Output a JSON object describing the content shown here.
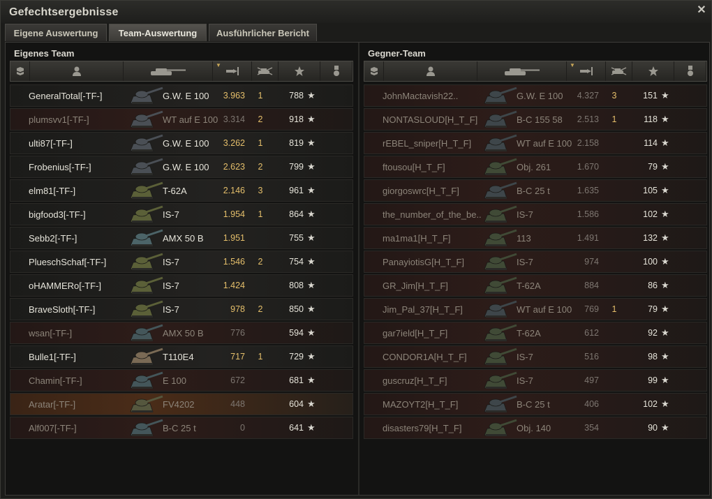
{
  "window": {
    "title": "Gefechtsergebnisse"
  },
  "tabs": [
    {
      "label": "Eigene Auswertung"
    },
    {
      "label": "Team-Auswertung"
    },
    {
      "label": "Ausführlicher Bericht"
    }
  ],
  "colors": {
    "accent": "#e5bf6b",
    "dead_row": "#2d1c19",
    "highlight_row": "#4a2c18"
  },
  "icons": {
    "header": [
      "squad-icon",
      "player-icon",
      "tank-icon",
      "damage-icon",
      "kills-icon",
      "xp-star-icon",
      "medal-icon"
    ],
    "row_star": "★"
  },
  "own_team": {
    "title": "Eigenes Team",
    "rows": [
      {
        "name": "GeneralTotal[-TF-]",
        "vehicle": "G.W. E 100",
        "damage": "3.963",
        "kills": "1",
        "xp": "788",
        "dead": false,
        "tank_color": "#4a4f55"
      },
      {
        "name": "plumsvv1[-TF-]",
        "vehicle": "WT auf E 100",
        "damage": "3.314",
        "kills": "2",
        "xp": "918",
        "dead": true,
        "tank_color": "#4a4f55"
      },
      {
        "name": "ulti87[-TF-]",
        "vehicle": "G.W. E 100",
        "damage": "3.262",
        "kills": "1",
        "xp": "819",
        "dead": false,
        "tank_color": "#4a4f55"
      },
      {
        "name": "Frobenius[-TF-]",
        "vehicle": "G.W. E 100",
        "damage": "2.623",
        "kills": "2",
        "xp": "799",
        "dead": false,
        "tank_color": "#4a4f55"
      },
      {
        "name": "elm81[-TF-]",
        "vehicle": "T-62A",
        "damage": "2.146",
        "kills": "3",
        "xp": "961",
        "dead": false,
        "tank_color": "#5b6038"
      },
      {
        "name": "bigfood3[-TF-]",
        "vehicle": "IS-7",
        "damage": "1.954",
        "kills": "1",
        "xp": "864",
        "dead": false,
        "tank_color": "#5b6038"
      },
      {
        "name": "Sebb2[-TF-]",
        "vehicle": "AMX 50 B",
        "damage": "1.951",
        "kills": "",
        "xp": "755",
        "dead": false,
        "tank_color": "#4c6468"
      },
      {
        "name": "PlueschSchaf[-TF-]",
        "vehicle": "IS-7",
        "damage": "1.546",
        "kills": "2",
        "xp": "754",
        "dead": false,
        "tank_color": "#5b6038"
      },
      {
        "name": "oHAMMERo[-TF-]",
        "vehicle": "IS-7",
        "damage": "1.424",
        "kills": "",
        "xp": "808",
        "dead": false,
        "tank_color": "#5b6038"
      },
      {
        "name": "BraveSloth[-TF-]",
        "vehicle": "IS-7",
        "damage": "978",
        "kills": "2",
        "xp": "850",
        "dead": false,
        "tank_color": "#5b6038"
      },
      {
        "name": "wsan[-TF-]",
        "vehicle": "AMX 50 B",
        "damage": "776",
        "kills": "",
        "xp": "594",
        "dead": true,
        "tank_color": "#44565a"
      },
      {
        "name": "Bulle1[-TF-]",
        "vehicle": "T110E4",
        "damage": "717",
        "kills": "1",
        "xp": "729",
        "dead": false,
        "tank_color": "#7a6a55"
      },
      {
        "name": "Chamin[-TF-]",
        "vehicle": "E 100",
        "damage": "672",
        "kills": "",
        "xp": "681",
        "dead": true,
        "tank_color": "#44565a"
      },
      {
        "name": "Aratar[-TF-]",
        "vehicle": "FV4202",
        "damage": "448",
        "kills": "",
        "xp": "604",
        "dead": true,
        "highlight": true,
        "tank_color": "#55573e"
      },
      {
        "name": "Alf007[-TF-]",
        "vehicle": "B-C 25 t",
        "damage": "0",
        "kills": "",
        "xp": "641",
        "dead": true,
        "tank_color": "#44565a"
      }
    ]
  },
  "enemy_team": {
    "title": "Gegner-Team",
    "rows": [
      {
        "name": "JohnMactavish22..",
        "vehicle": "G.W. E 100",
        "damage": "4.327",
        "kills": "3",
        "xp": "151",
        "dead": true,
        "tank_color": "#3e464a"
      },
      {
        "name": "NONTASLOUD[H_T_F]",
        "vehicle": "B-C 155 58",
        "damage": "2.513",
        "kills": "1",
        "xp": "118",
        "dead": true,
        "tank_color": "#3e464a"
      },
      {
        "name": "rEBEL_sniper[H_T_F]",
        "vehicle": "WT auf E 100",
        "damage": "2.158",
        "kills": "",
        "xp": "114",
        "dead": true,
        "tank_color": "#3e464a"
      },
      {
        "name": "ftousou[H_T_F]",
        "vehicle": "Obj. 261",
        "damage": "1.670",
        "kills": "",
        "xp": "79",
        "dead": true,
        "tank_color": "#404a36"
      },
      {
        "name": "giorgoswrc[H_T_F]",
        "vehicle": "B-C 25 t",
        "damage": "1.635",
        "kills": "",
        "xp": "105",
        "dead": true,
        "tank_color": "#3e464a"
      },
      {
        "name": "the_number_of_the_be..",
        "vehicle": "IS-7",
        "damage": "1.586",
        "kills": "",
        "xp": "102",
        "dead": true,
        "tank_color": "#404a36"
      },
      {
        "name": "ma1ma1[H_T_F]",
        "vehicle": "113",
        "damage": "1.491",
        "kills": "",
        "xp": "132",
        "dead": true,
        "tank_color": "#404a36"
      },
      {
        "name": "PanayiotisG[H_T_F]",
        "vehicle": "IS-7",
        "damage": "974",
        "kills": "",
        "xp": "100",
        "dead": true,
        "tank_color": "#404a36"
      },
      {
        "name": "GR_Jim[H_T_F]",
        "vehicle": "T-62A",
        "damage": "884",
        "kills": "",
        "xp": "86",
        "dead": true,
        "tank_color": "#404a36"
      },
      {
        "name": "Jim_Pal_37[H_T_F]",
        "vehicle": "WT auf E 100",
        "damage": "769",
        "kills": "1",
        "xp": "79",
        "dead": true,
        "tank_color": "#3e464a"
      },
      {
        "name": "gar7ield[H_T_F]",
        "vehicle": "T-62A",
        "damage": "612",
        "kills": "",
        "xp": "92",
        "dead": true,
        "tank_color": "#404a36"
      },
      {
        "name": "CONDOR1A[H_T_F]",
        "vehicle": "IS-7",
        "damage": "516",
        "kills": "",
        "xp": "98",
        "dead": true,
        "tank_color": "#404a36"
      },
      {
        "name": "guscruz[H_T_F]",
        "vehicle": "IS-7",
        "damage": "497",
        "kills": "",
        "xp": "99",
        "dead": true,
        "tank_color": "#404a36"
      },
      {
        "name": "MAZOYT2[H_T_F]",
        "vehicle": "B-C 25 t",
        "damage": "406",
        "kills": "",
        "xp": "102",
        "dead": true,
        "tank_color": "#3e464a"
      },
      {
        "name": "disasters79[H_T_F]",
        "vehicle": "Obj. 140",
        "damage": "354",
        "kills": "",
        "xp": "90",
        "dead": true,
        "tank_color": "#404a36"
      }
    ]
  }
}
